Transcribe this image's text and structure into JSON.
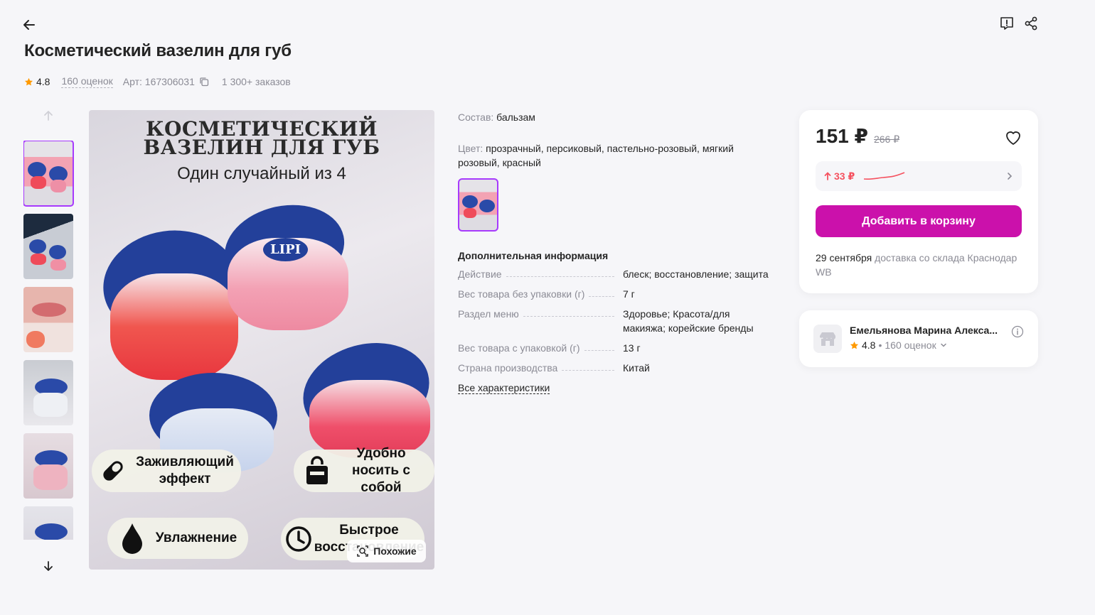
{
  "header": {
    "title": "Косметический вазелин для губ"
  },
  "meta": {
    "rating": "4.8",
    "reviews": "160 оценок",
    "article": "Арт: 167306031",
    "orders": "1 300+ заказов"
  },
  "main_image": {
    "heading": "КОСМЕТИЧЕСКИЙ ВАЗЕЛИН ДЛЯ ГУБ",
    "subheading": "Один случайный из 4",
    "badge_healing_line1": "Заживляющий",
    "badge_healing_line2": "эффект",
    "badge_portable_line1": "Удобно",
    "badge_portable_line2": "носить с собой",
    "badge_moist": "Увлажнение",
    "badge_fast_line1": "Быстрое",
    "badge_fast_line2": "восстановление",
    "jar_label": "LIPI",
    "similar_button": "Похожие"
  },
  "info": {
    "composition_label": "Состав:",
    "composition_value": "бальзам",
    "color_label": "Цвет:",
    "color_value": "прозрачный, персиковый, пастельно-розовый, мягкий розовый, красный",
    "additional_title": "Дополнительная информация",
    "specs": [
      {
        "k": "Действие",
        "v": "блеск; восстановление; защита"
      },
      {
        "k": "Вес товара без упаковки (г)",
        "v": "7 г"
      },
      {
        "k": "Раздел меню",
        "v": "Здоровье; Красота/для макияжа; корейские бренды"
      },
      {
        "k": "Вес товара с упаковкой (г)",
        "v": "13 г"
      },
      {
        "k": "Страна производства",
        "v": "Китай"
      }
    ],
    "all_characteristics": "Все характеристики"
  },
  "price_card": {
    "price": "151 ₽",
    "old_price": "266 ₽",
    "price_change": "33 ₽",
    "add_to_cart": "Добавить в корзину",
    "delivery_date": "29 сентября",
    "delivery_text": "доставка со склада Краснодар WB"
  },
  "seller": {
    "name": "Емельянова Марина Алекса...",
    "rating": "4.8",
    "reviews": "160 оценок"
  },
  "colors": {
    "accent": "#cb11ab",
    "active_outline": "#a73afd",
    "star": "#ff9a00",
    "price_up": "#f5515f"
  }
}
